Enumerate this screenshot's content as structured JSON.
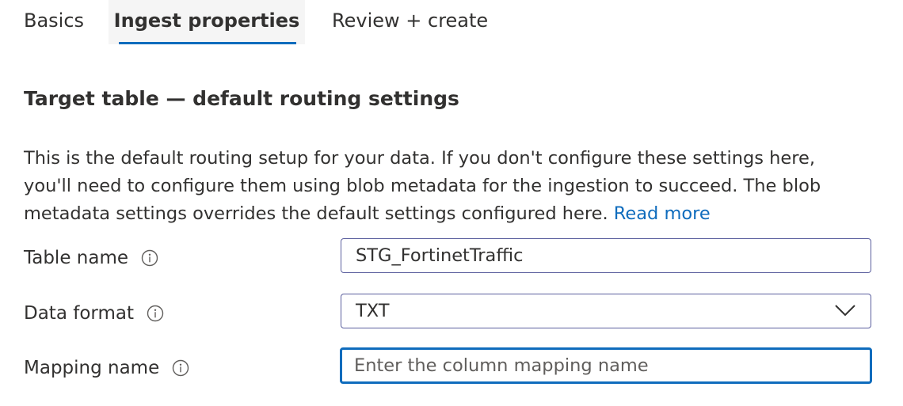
{
  "tabs": [
    {
      "label": "Basics",
      "active": false
    },
    {
      "label": "Ingest properties",
      "active": true
    },
    {
      "label": "Review + create",
      "active": false
    }
  ],
  "section": {
    "title": "Target table — default routing settings",
    "description": "This is the default routing setup for your data. If you don't configure these settings here, you'll need to configure them using blob metadata for the ingestion to succeed. The blob metadata settings overrides the default settings configured here.",
    "read_more": "Read more"
  },
  "form": {
    "table_name": {
      "label": "Table name",
      "value": "STG_FortinetTraffic",
      "icon": "info-icon"
    },
    "data_format": {
      "label": "Data format",
      "value": "TXT",
      "icon": "info-icon"
    },
    "mapping_name": {
      "label": "Mapping name",
      "value": "",
      "placeholder": "Enter the column mapping name",
      "icon": "info-icon"
    }
  },
  "colors": {
    "accent": "#0f6cbd",
    "text": "#323130",
    "border": "#5b5f9e"
  }
}
